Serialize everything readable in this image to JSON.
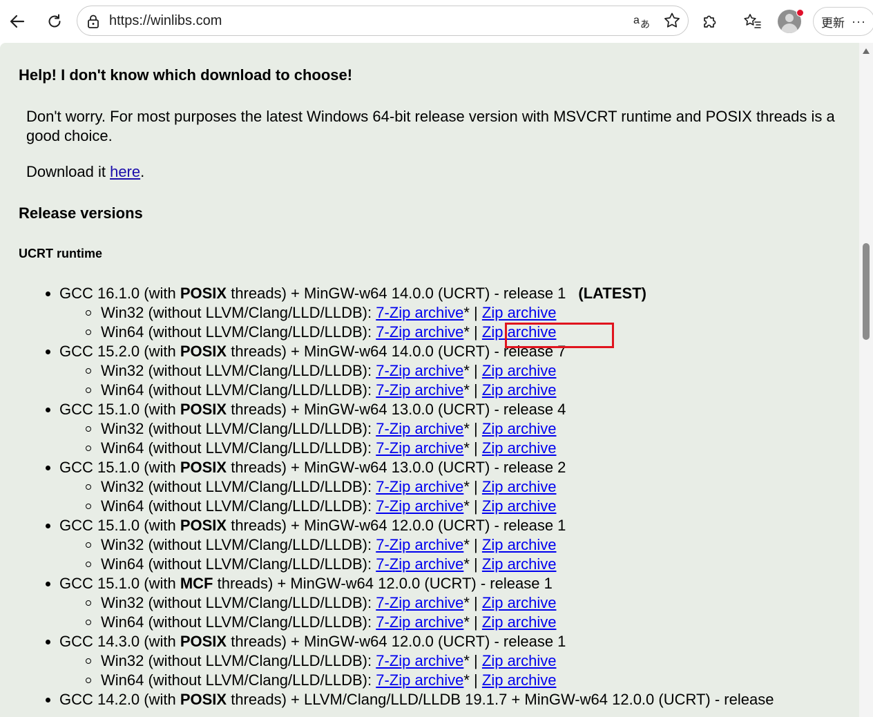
{
  "browser": {
    "url": "https://winlibs.com",
    "update_label": "更新",
    "more_label": "···",
    "colors": {
      "profile_dot": "#e0102b"
    }
  },
  "page": {
    "help_heading": "Help! I don't know which download to choose!",
    "help_text": "Don't worry. For most purposes the latest Windows 64-bit release version with MSVCRT runtime and POSIX threads is a good choice.",
    "download_prefix": "Download it ",
    "download_link": "here",
    "download_suffix": ".",
    "release_heading": "Release versions",
    "runtime_heading": "UCRT runtime",
    "latest_tag": "(LATEST)",
    "sep": " | ",
    "star": "*",
    "win32_label": "Win32 (without LLVM/Clang/LLD/LLDB): ",
    "win64_label": "Win64 (without LLVM/Clang/LLD/LLDB): ",
    "zip7_label": "7-Zip archive",
    "zip_label": "Zip archive",
    "releases": [
      {
        "gcc": "GCC 16.1.0 (with ",
        "threads": "POSIX",
        "rest": " threads) + MinGW-w64 14.0.0 (UCRT) - release 1",
        "latest": true
      },
      {
        "gcc": "GCC 15.2.0 (with ",
        "threads": "POSIX",
        "rest": " threads) + MinGW-w64 14.0.0 (UCRT) - release 7"
      },
      {
        "gcc": "GCC 15.1.0 (with ",
        "threads": "POSIX",
        "rest": " threads) + MinGW-w64 13.0.0 (UCRT) - release 4"
      },
      {
        "gcc": "GCC 15.1.0 (with ",
        "threads": "POSIX",
        "rest": " threads) + MinGW-w64 13.0.0 (UCRT) - release 2"
      },
      {
        "gcc": "GCC 15.1.0 (with ",
        "threads": "POSIX",
        "rest": " threads) + MinGW-w64 12.0.0 (UCRT) - release 1"
      },
      {
        "gcc": "GCC 15.1.0 (with ",
        "threads": "MCF",
        "rest": " threads) + MinGW-w64 12.0.0 (UCRT) - release 1"
      },
      {
        "gcc": "GCC 14.3.0 (with ",
        "threads": "POSIX",
        "rest": " threads) + MinGW-w64 12.0.0 (UCRT) - release 1"
      },
      {
        "gcc": "GCC 14.2.0 (with ",
        "threads": "POSIX",
        "rest": " threads) + LLVM/Clang/LLD/LLDB 19.1.7 + MinGW-w64 12.0.0 (UCRT) - release"
      }
    ],
    "colors": {
      "background": "#e8ede6",
      "link": "#0000ee",
      "highlight_box": "#e0141e"
    }
  }
}
